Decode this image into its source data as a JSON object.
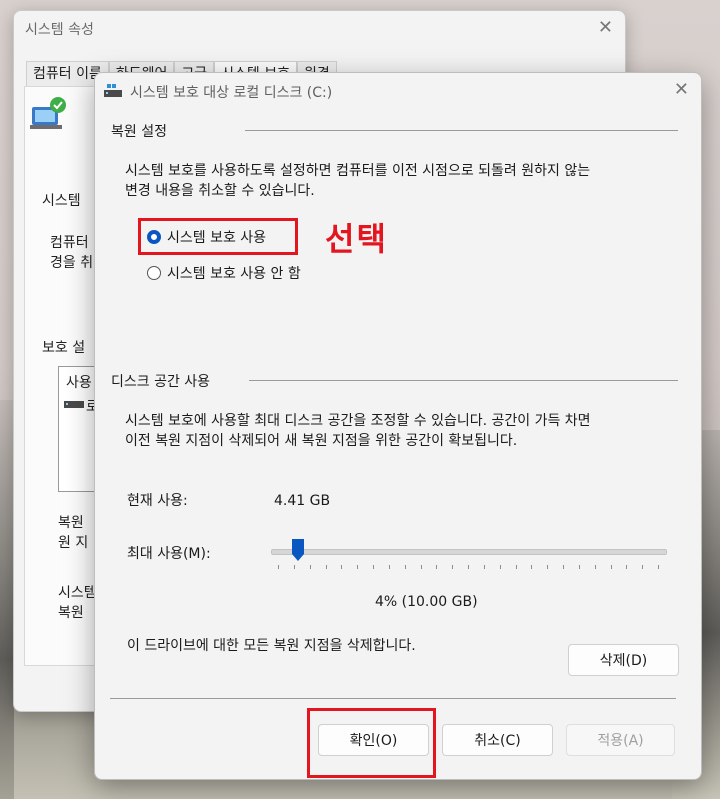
{
  "back_window": {
    "title": "시스템 속성",
    "tabs": [
      "컴퓨터 이름",
      "하드웨어",
      "고급",
      "시스템 보호",
      "원격"
    ],
    "texts": {
      "system_label": "시스템",
      "computer_line1": "컴퓨터",
      "computer_line2": "경을 취",
      "protection_settings": "보호 설",
      "list_header": "사용",
      "list_item": "로",
      "restore_line1": "복원",
      "restore_line2": "원 지",
      "system_line1": "시스템",
      "system_line2": "복원"
    }
  },
  "dialog": {
    "title": "시스템 보호 대상 로컬 디스크 (C:)",
    "restore_settings": {
      "heading": "복원 설정",
      "description_line1": "시스템 보호를 사용하도록 설정하면 컴퓨터를 이전 시점으로 되돌려 원하지 않는",
      "description_line2": "변경 내용을 취소할 수 있습니다.",
      "options": [
        {
          "label": "시스템 보호 사용",
          "checked": true
        },
        {
          "label": "시스템 보호 사용 안 함",
          "checked": false
        }
      ]
    },
    "annotation": "선택",
    "disk_space": {
      "heading": "디스크 공간 사용",
      "description_line1": "시스템 보호에 사용할 최대 디스크 공간을 조정할 수 있습니다. 공간이 가득 차면",
      "description_line2": "이전 복원 지점이 삭제되어 새 복원 지점을 위한 공간이 확보됩니다.",
      "current_usage_label": "현재 사용:",
      "current_usage_value": "4.41 GB",
      "max_usage_label": "최대 사용(M):",
      "max_usage_fraction": 0.04,
      "max_usage_value": "4% (10.00 GB)",
      "delete_text": "이 드라이브에 대한 모든 복원 지점을 삭제합니다.",
      "delete_button": "삭제(D)"
    },
    "buttons": {
      "ok": "확인(O)",
      "cancel": "취소(C)",
      "apply": "적용(A)"
    }
  },
  "colors": {
    "accent": "#0b57c1",
    "annotation_red": "#e3151f"
  }
}
